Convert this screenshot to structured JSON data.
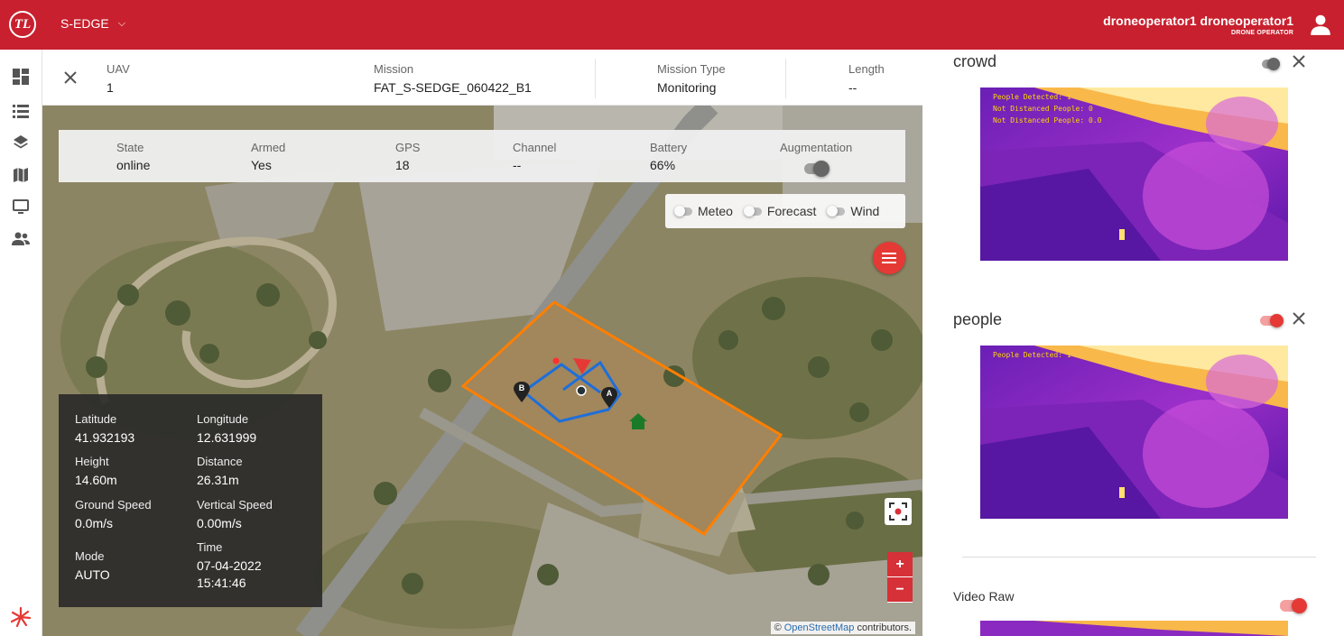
{
  "header": {
    "logo_text": "TL",
    "project": "S-EDGE",
    "user_name": "droneoperator1 droneoperator1",
    "user_role": "DRONE OPERATOR"
  },
  "sidebar": {
    "items": [
      "dashboard-icon",
      "list-icon",
      "layers-icon",
      "map-icon",
      "monitor-icon",
      "people-icon"
    ]
  },
  "mission": {
    "uav_label": "UAV",
    "uav_value": "1",
    "mission_label": "Mission",
    "mission_value": "FAT_S-SEDGE_060422_B1",
    "type_label": "Mission Type",
    "type_value": "Monitoring",
    "length_label": "Length",
    "length_value": "--"
  },
  "status": {
    "state_label": "State",
    "state_value": "online",
    "armed_label": "Armed",
    "armed_value": "Yes",
    "gps_label": "GPS",
    "gps_value": "18",
    "channel_label": "Channel",
    "channel_value": "--",
    "battery_label": "Battery",
    "battery_value": "66%",
    "augmentation_label": "Augmentation"
  },
  "layers": {
    "meteo": "Meteo",
    "forecast": "Forecast",
    "wind": "Wind"
  },
  "map": {
    "waypoint_a": "A",
    "waypoint_b": "B",
    "attribution_prefix": "©",
    "attribution_link": "OpenStreetMap",
    "attribution_suffix": "contributors.",
    "zoom_in": "+",
    "zoom_out": "−"
  },
  "telemetry": {
    "lat_label": "Latitude",
    "lat_value": "41.932193",
    "lon_label": "Longitude",
    "lon_value": "12.631999",
    "height_label": "Height",
    "height_value": "14.60m",
    "distance_label": "Distance",
    "distance_value": "26.31m",
    "gspeed_label": "Ground Speed",
    "gspeed_value": "0.0m/s",
    "vspeed_label": "Vertical Speed",
    "vspeed_value": "0.00m/s",
    "mode_label": "Mode",
    "mode_value": "AUTO",
    "time_label": "Time",
    "time_date": "07-04-2022",
    "time_clock": "15:41:46"
  },
  "feeds": {
    "crowd": {
      "title": "crowd",
      "line1": "People Detected: 1",
      "line2": "Not Distanced People: 0",
      "line3": "Not Distanced People: 0.0"
    },
    "people": {
      "title": "people",
      "line1": "People Detected: 1"
    },
    "raw": {
      "title": "Video Raw"
    }
  },
  "colors": {
    "brand": "#c8202e",
    "accent": "#e53935",
    "geofence": "#ff7f00",
    "path": "#1e6fd9"
  }
}
